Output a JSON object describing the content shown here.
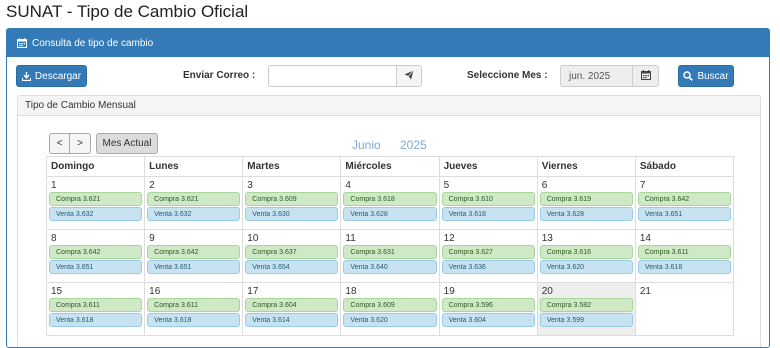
{
  "page_title": "SUNAT - Tipo de Cambio Oficial",
  "panel": {
    "heading": "Consulta de tipo de cambio",
    "heading_icon": "calendar-icon"
  },
  "toolbar": {
    "download_label": "Descargar",
    "download_icon": "download-icon",
    "email_label": "Enviar Correo :",
    "email_value": "",
    "send_icon": "paper-plane-icon",
    "month_label": "Seleccione Mes :",
    "month_value": "jun. 2025",
    "calendar_icon": "calendar-icon",
    "search_label": "Buscar",
    "search_icon": "search-icon"
  },
  "monthly": {
    "heading": "Tipo de Cambio Mensual",
    "prev_label": "<",
    "next_label": ">",
    "current_month_label": "Mes Actual",
    "month_name": "Junio",
    "year": "2025"
  },
  "weekdays": [
    "Domingo",
    "Lunes",
    "Martes",
    "Miércoles",
    "Jueves",
    "Viernes",
    "Sábado"
  ],
  "weeks": [
    [
      {
        "day": "1",
        "compra": "Compra 3.621",
        "venta": "Venta 3.632"
      },
      {
        "day": "2",
        "compra": "Compra 3.621",
        "venta": "Venta 3.632"
      },
      {
        "day": "3",
        "compra": "Compra 3.609",
        "venta": "Venta 3.630"
      },
      {
        "day": "4",
        "compra": "Compra 3.618",
        "venta": "Venta 3.628"
      },
      {
        "day": "5",
        "compra": "Compra 3.610",
        "venta": "Venta 3.618"
      },
      {
        "day": "6",
        "compra": "Compra 3.619",
        "venta": "Venta 3.628"
      },
      {
        "day": "7",
        "compra": "Compra 3.642",
        "venta": "Venta 3.651"
      }
    ],
    [
      {
        "day": "8",
        "compra": "Compra 3.642",
        "venta": "Venta 3.651"
      },
      {
        "day": "9",
        "compra": "Compra 3.642",
        "venta": "Venta 3.651"
      },
      {
        "day": "10",
        "compra": "Compra 3.637",
        "venta": "Venta 3.654"
      },
      {
        "day": "11",
        "compra": "Compra 3.631",
        "venta": "Venta 3.640"
      },
      {
        "day": "12",
        "compra": "Compra 3.627",
        "venta": "Venta 3.636"
      },
      {
        "day": "13",
        "compra": "Compra 3.616",
        "venta": "Venta 3.620"
      },
      {
        "day": "14",
        "compra": "Compra 3.611",
        "venta": "Venta 3.618"
      }
    ],
    [
      {
        "day": "15",
        "compra": "Compra 3.611",
        "venta": "Venta 3.618"
      },
      {
        "day": "16",
        "compra": "Compra 3.611",
        "venta": "Venta 3.618"
      },
      {
        "day": "17",
        "compra": "Compra 3.604",
        "venta": "Venta 3.614"
      },
      {
        "day": "18",
        "compra": "Compra 3.609",
        "venta": "Venta 3.620"
      },
      {
        "day": "19",
        "compra": "Compra 3.596",
        "venta": "Venta 3.604"
      },
      {
        "day": "20",
        "compra": "Compra 3.582",
        "venta": "Venta 3.599",
        "today": true
      },
      {
        "day": "21"
      }
    ]
  ]
}
